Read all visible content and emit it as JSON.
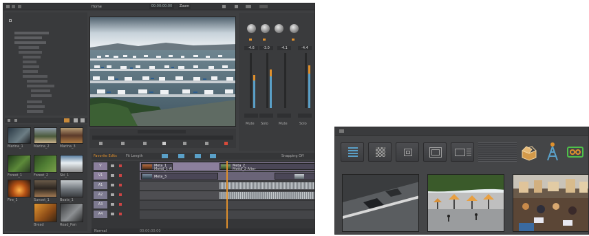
{
  "editor": {
    "bin_title": "Home",
    "viewer": {
      "title": "Home",
      "timecode": "00:00:00:00",
      "zoom": "Zoom"
    },
    "timeline": {
      "sequence_name": "Favorite Edits",
      "fit_label": "Fit Length",
      "snapping_label": "Snapping Off",
      "tracks": [
        "V",
        "V1",
        "A1",
        "A2",
        "A3",
        "A4"
      ],
      "clip_labels": [
        "Meta_1",
        "Metta_1 Alter",
        "Meta_2",
        "Metta_2 Alter",
        "Meta_3"
      ],
      "footer": [
        "Normal",
        "00:00:00:00"
      ]
    },
    "browser_thumbs": [
      {
        "label": "Marina_1"
      },
      {
        "label": "Marina_2"
      },
      {
        "label": "Marina_3"
      },
      {
        "label": "Forest_1"
      },
      {
        "label": "Forest_2"
      },
      {
        "label": "Ski_1"
      },
      {
        "label": "Fire_1"
      },
      {
        "label": "Sunset_1"
      },
      {
        "label": "Boats_1"
      },
      {
        "label": "Bread"
      },
      {
        "label": "Road_Pan"
      }
    ],
    "mixer": {
      "channel_values": [
        "-4.6",
        "-3.0",
        "-4.1",
        "-4.4"
      ],
      "bottom_labels": [
        "Mute",
        "Solo",
        "Mute",
        "Solo"
      ]
    }
  },
  "zoom_toolbar": {
    "buttons": [
      "list-view-icon",
      "grid-view-icon",
      "small-frame-icon",
      "medium-frame-icon",
      "filmstrip-icon",
      "open-box-icon",
      "antenna-icon",
      "tape-icon"
    ]
  },
  "colors": {
    "accent_orange": "#e0902c",
    "meter_blue": "#5aa0c8",
    "video_track": "#8b7f9c",
    "audio_track": "#5a5a5e"
  }
}
